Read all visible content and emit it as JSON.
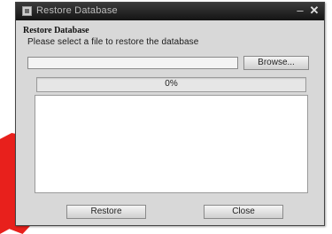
{
  "window": {
    "title": "Restore Database",
    "minimize_glyph": "–",
    "close_glyph": "✕"
  },
  "section": {
    "heading": "Restore Database",
    "instruction": "Please select a file to restore the database"
  },
  "file_input": {
    "value": ""
  },
  "buttons": {
    "browse": "Browse...",
    "restore": "Restore",
    "close": "Close"
  },
  "progress": {
    "label": "0%",
    "value": 0
  },
  "log": {
    "content": ""
  },
  "colors": {
    "titlebar": "#1f1f1f",
    "window_bg": "#d8d8d8",
    "background_red": "#e8201c"
  },
  "icons": {
    "app": "app-icon",
    "minimize": "minimize-icon",
    "close": "close-icon"
  }
}
